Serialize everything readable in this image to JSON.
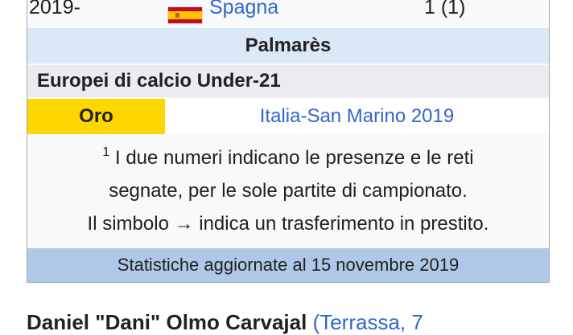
{
  "career_row": {
    "year": "2019-",
    "flag_icon": "spain-flag-icon",
    "country": "Spagna",
    "stats": "1 (1)"
  },
  "palmares": {
    "header": "Palmarès",
    "competition": "Europei di calcio Under-21",
    "medal": "Oro",
    "medal_color": "#ffd700",
    "event": "Italia-San Marino 2019"
  },
  "note": {
    "superscript": "1",
    "line1": "I due numeri indicano le presenze e le reti",
    "line2": "segnate, per le sole partite di campionato.",
    "line3": "Il simbolo → indica un trasferimento in prestito."
  },
  "footer": "Statistiche aggiornate al 15 novembre 2019",
  "article": {
    "start": "Daniel \"Dani\" Olmo Carvajal",
    "link": "(Terrassa, 7"
  }
}
